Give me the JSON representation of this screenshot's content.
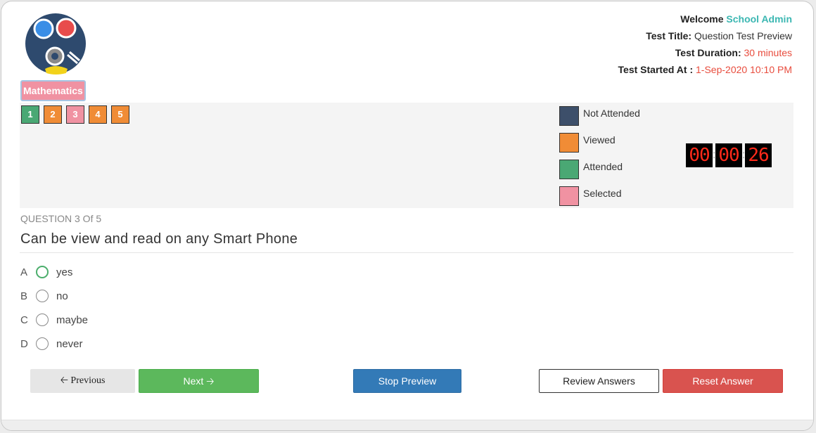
{
  "header": {
    "welcome_label": "Welcome",
    "user_name": "School Admin",
    "test_title_label": "Test Title:",
    "test_title": "Question Test Preview",
    "duration_label": "Test Duration:",
    "duration": "30 minutes",
    "started_label": "Test Started At :",
    "started_at": "1-Sep-2020 10:10 PM"
  },
  "subject_tab": "Mathematics",
  "question_nav": [
    {
      "label": "1",
      "status": "attended",
      "color": "#4aa874"
    },
    {
      "label": "2",
      "status": "viewed",
      "color": "#f08c36"
    },
    {
      "label": "3",
      "status": "selected",
      "color": "#f092a2"
    },
    {
      "label": "4",
      "status": "viewed",
      "color": "#f08c36"
    },
    {
      "label": "5",
      "status": "viewed",
      "color": "#f08c36"
    }
  ],
  "legend": [
    {
      "label": "Not Attended",
      "color": "#3d4f6a"
    },
    {
      "label": "Viewed",
      "color": "#f08c36"
    },
    {
      "label": "Attended",
      "color": "#4aa874"
    },
    {
      "label": "Selected",
      "color": "#f092a2"
    }
  ],
  "timer": {
    "hours": "00",
    "minutes": "00",
    "seconds": "26"
  },
  "question": {
    "number_text": "QUESTION 3 Of 5",
    "text": "Can be view and read on any Smart Phone",
    "options": [
      {
        "letter": "A",
        "text": "yes",
        "checked": true
      },
      {
        "letter": "B",
        "text": "no",
        "checked": false
      },
      {
        "letter": "C",
        "text": "maybe",
        "checked": false
      },
      {
        "letter": "D",
        "text": "never",
        "checked": false
      }
    ]
  },
  "buttons": {
    "previous": "Previous",
    "next": "Next",
    "stop_preview": "Stop Preview",
    "review_answers": "Review Answers",
    "reset_answer": "Reset Answer"
  },
  "icons": {
    "previous": "arrow-left-icon",
    "next": "arrow-right-icon"
  }
}
